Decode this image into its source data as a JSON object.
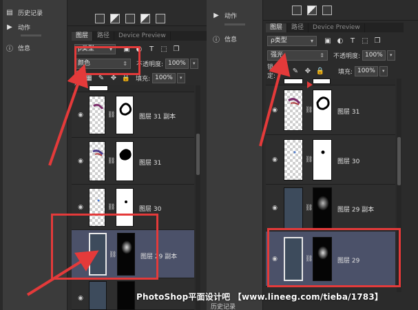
{
  "left": {
    "sidebar": [
      {
        "icon": "history-icon",
        "label": "历史记录"
      },
      {
        "icon": "play-icon",
        "label": "动作"
      },
      {
        "icon": "info-icon",
        "label": "信息"
      }
    ],
    "tabs": [
      "图层",
      "路径",
      "Device Preview"
    ],
    "filter_label": "ρ类型",
    "blend_mode": "颜色",
    "opacity_label": "不透明度:",
    "opacity_value": "100%",
    "fill_label": "填充:",
    "fill_value": "100%",
    "lock_label": "锁定",
    "layers": [
      {
        "name": "图层 31 副本"
      },
      {
        "name": "图层 31"
      },
      {
        "name": "图层 30"
      },
      {
        "name": "图层 29 副本"
      },
      {
        "name": ""
      }
    ]
  },
  "right": {
    "sidebar": [
      {
        "icon": "play-icon",
        "label": "动作"
      },
      {
        "icon": "info-icon",
        "label": "信息"
      }
    ],
    "tabs": [
      "图层",
      "路径",
      "Device Preview"
    ],
    "filter_label": "ρ类型",
    "blend_mode": "强光",
    "opacity_label": "不透明度:",
    "opacity_value": "100%",
    "fill_label": "填充:",
    "fill_value": "100%",
    "lock_label": "锁定:",
    "layers": [
      {
        "name": "图层 31"
      },
      {
        "name": "图层 30"
      },
      {
        "name": "图层 29 副本"
      },
      {
        "name": "图层 29"
      }
    ]
  },
  "watermark": "PhotoShop平面设计吧 【www.lineeg.com/tieba/1783】",
  "bottom_panel_label": "历史记录",
  "colors": {
    "highlight": "#e43a3a",
    "selected_layer": "#4b5169",
    "panel_bg": "#2b2b2b"
  }
}
